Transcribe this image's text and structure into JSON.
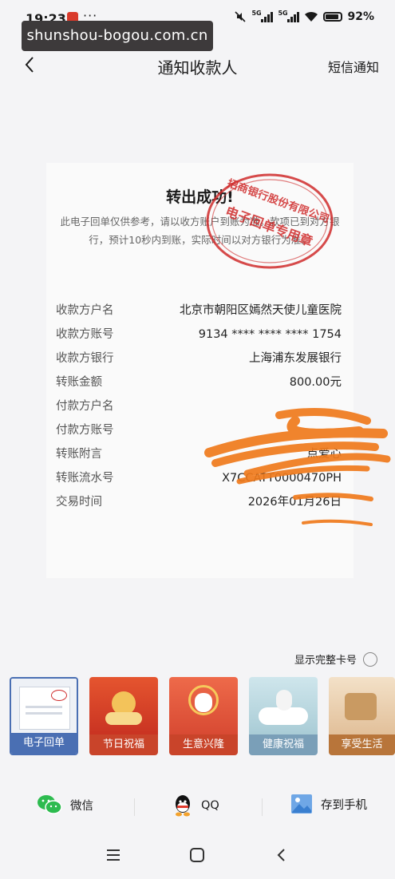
{
  "status_bar": {
    "time": "19:23",
    "more": "···",
    "battery": "92%",
    "net1": "5G",
    "net2": "5G"
  },
  "watermark_url": "shunshou-bogou.com.cn",
  "header": {
    "title": "通知收款人",
    "action": "短信通知"
  },
  "receipt": {
    "title": "转出成功!",
    "note": "此电子回单仅供参考，请以收方账户到账为准。款项已到对方银行，预计10秒内到账，实际时间以对方银行为准。",
    "seal": {
      "text_outer": "招商银行股份有限公司",
      "text_inner": "电子回单专用章",
      "color": "#cf2a2a"
    },
    "rows": [
      {
        "label": "收款方户名",
        "value": "北京市朝阳区嫣然天使儿童医院"
      },
      {
        "label": "收款方账号",
        "value": "9134 **** **** **** 1754"
      },
      {
        "label": "收款方银行",
        "value": "上海浦东发展银行"
      },
      {
        "label": "转账金额",
        "value": "800.00元"
      },
      {
        "label": "付款方户名",
        "value": ""
      },
      {
        "label": "付款方账号",
        "value": ""
      },
      {
        "label": "转账附言",
        "value": "点爱心"
      },
      {
        "label": "转账流水号",
        "value": "X7CCATT0000470PH"
      },
      {
        "label": "交易时间",
        "value": "2026年01月26日"
      }
    ],
    "redaction_color": "#f07a1c"
  },
  "show_full_card": {
    "label": "显示完整卡号",
    "checked": false
  },
  "templates": [
    {
      "label": "电子回单",
      "selected": true,
      "color": "#4a6fb3"
    },
    {
      "label": "节日祝福",
      "selected": false,
      "color": "#c9442a"
    },
    {
      "label": "生意兴隆",
      "selected": false,
      "color": "#c9442a"
    },
    {
      "label": "健康祝福",
      "selected": false,
      "color": "#7a9fb8"
    },
    {
      "label": "享受生活",
      "selected": false,
      "color": "#b8753a"
    }
  ],
  "share": [
    {
      "label": "微信",
      "icon": "wechat-icon"
    },
    {
      "label": "QQ",
      "icon": "qq-icon"
    },
    {
      "label": "存到手机",
      "icon": "image-save-icon"
    }
  ],
  "navbar": {
    "menu": "menu-icon",
    "home": "home-icon",
    "back": "back-icon"
  }
}
